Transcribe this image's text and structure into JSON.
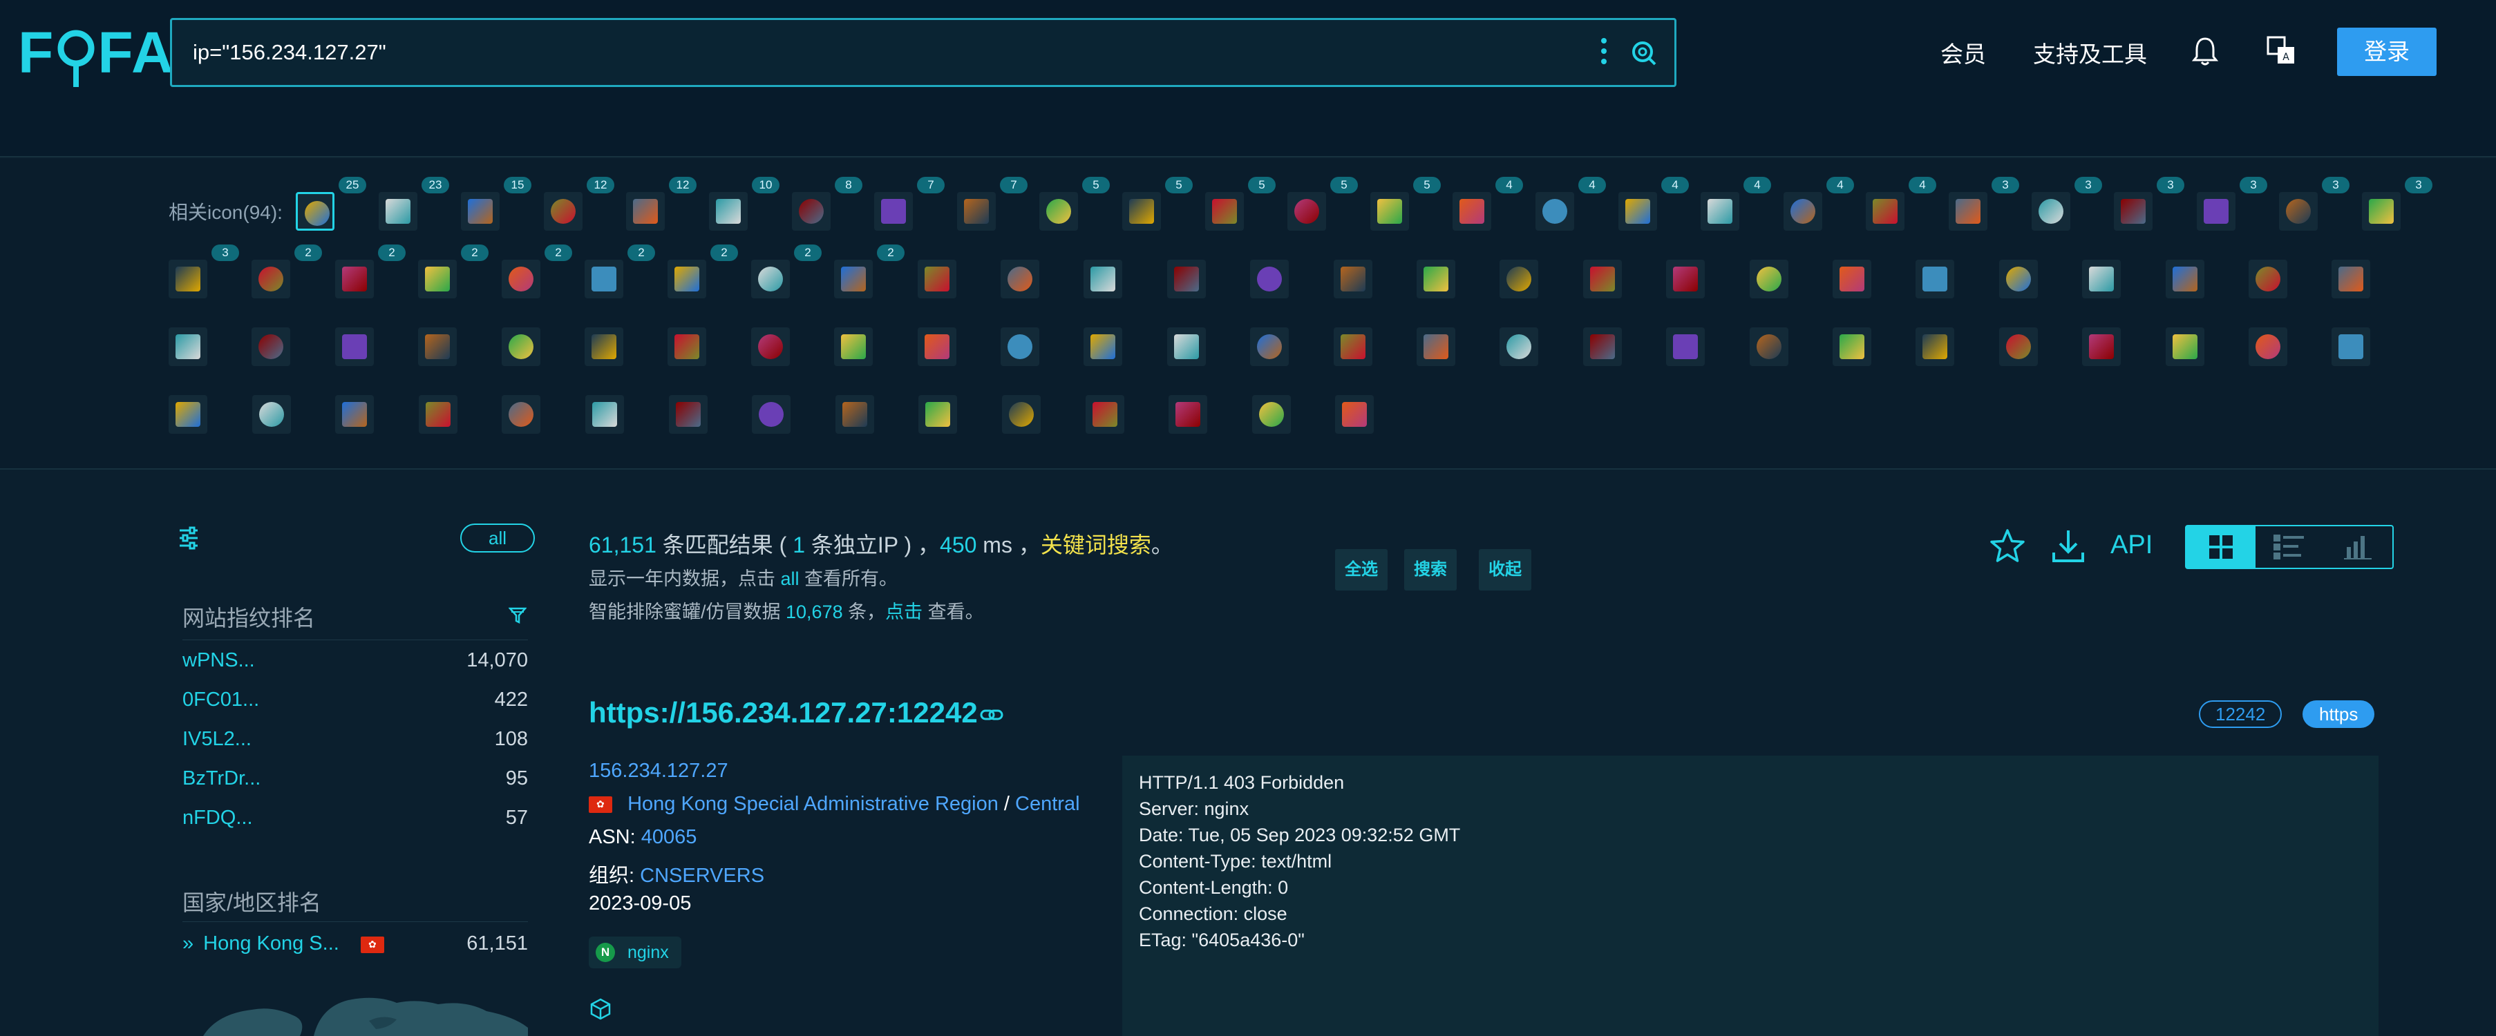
{
  "header": {
    "logo_text_left": "F",
    "logo_text_right": "FA",
    "search_query": "ip=\"156.234.127.27\"",
    "nav_member": "会员",
    "nav_tools": "支持及工具",
    "login_label": "登录"
  },
  "icon_panel": {
    "label": "相关icon(94):",
    "row1_counts": [
      "25",
      "23",
      "15",
      "12",
      "12",
      "10",
      "8",
      "7",
      "7",
      "5",
      "5",
      "5",
      "5",
      "5",
      "4",
      "4",
      "4",
      "4",
      "4",
      "4",
      "3",
      "3",
      "3",
      "3",
      "3",
      "3"
    ],
    "row2_counts": [
      "3",
      "2",
      "2",
      "2",
      "2",
      "2",
      "2",
      "2",
      "2"
    ],
    "select_all": "全选",
    "search": "搜索",
    "collapse": "收起"
  },
  "sidebar": {
    "all_label": "all",
    "fingerprint_title": "网站指纹排名",
    "fingerprints": [
      {
        "name": "wPNS...",
        "count": "14,070"
      },
      {
        "name": "0FC01...",
        "count": "422"
      },
      {
        "name": "IV5L2...",
        "count": "108"
      },
      {
        "name": "BzTrDr...",
        "count": "95"
      },
      {
        "name": "nFDQ...",
        "count": "57"
      }
    ],
    "country_title": "国家/地区排名",
    "country_name": "Hong Kong S...",
    "country_count": "61,151"
  },
  "results": {
    "match_count": "61,151",
    "match_text": " 条匹配结果 ( ",
    "ip_count": "1",
    "ip_text": " 条独立IP ) ，",
    "ms": "450",
    "ms_text": " ms ，",
    "keyword_search": "关键词搜索",
    "period": "。",
    "line2_pre": "显示一年内数据，点击 ",
    "line2_link": "all",
    "line2_post": " 查看所有。",
    "line3_pre": "智能排除蜜罐/仿冒数据 ",
    "line3_num": "10,678",
    "line3_mid": " 条，",
    "line3_link": "点击",
    "line3_post": " 查看。",
    "api_label": "API"
  },
  "result_item": {
    "url": "https://156.234.127.27:12242",
    "port": "12242",
    "protocol": "https",
    "ip": "156.234.127.27",
    "region": "Hong Kong Special Administrative Region",
    "region_sep": " / ",
    "city": "Central",
    "asn_label": "ASN: ",
    "asn": "40065",
    "org_label": "组织: ",
    "org": "CNSERVERS",
    "date": "2023-09-05",
    "server_tag": "nginx",
    "banner": [
      "HTTP/1.1 403 Forbidden",
      "Server: nginx",
      "Date: Tue, 05 Sep 2023 09:32:52 GMT",
      "Content-Type: text/html",
      "Content-Length: 0",
      "Connection: close",
      "ETag: \"6405a436-0\""
    ]
  },
  "colors": {
    "accent": "#23d3e6",
    "background": "#0b1f2e",
    "link_blue": "#4fa7ff",
    "highlight_yellow": "#f3e24c",
    "login_blue": "#2e9cf0"
  }
}
